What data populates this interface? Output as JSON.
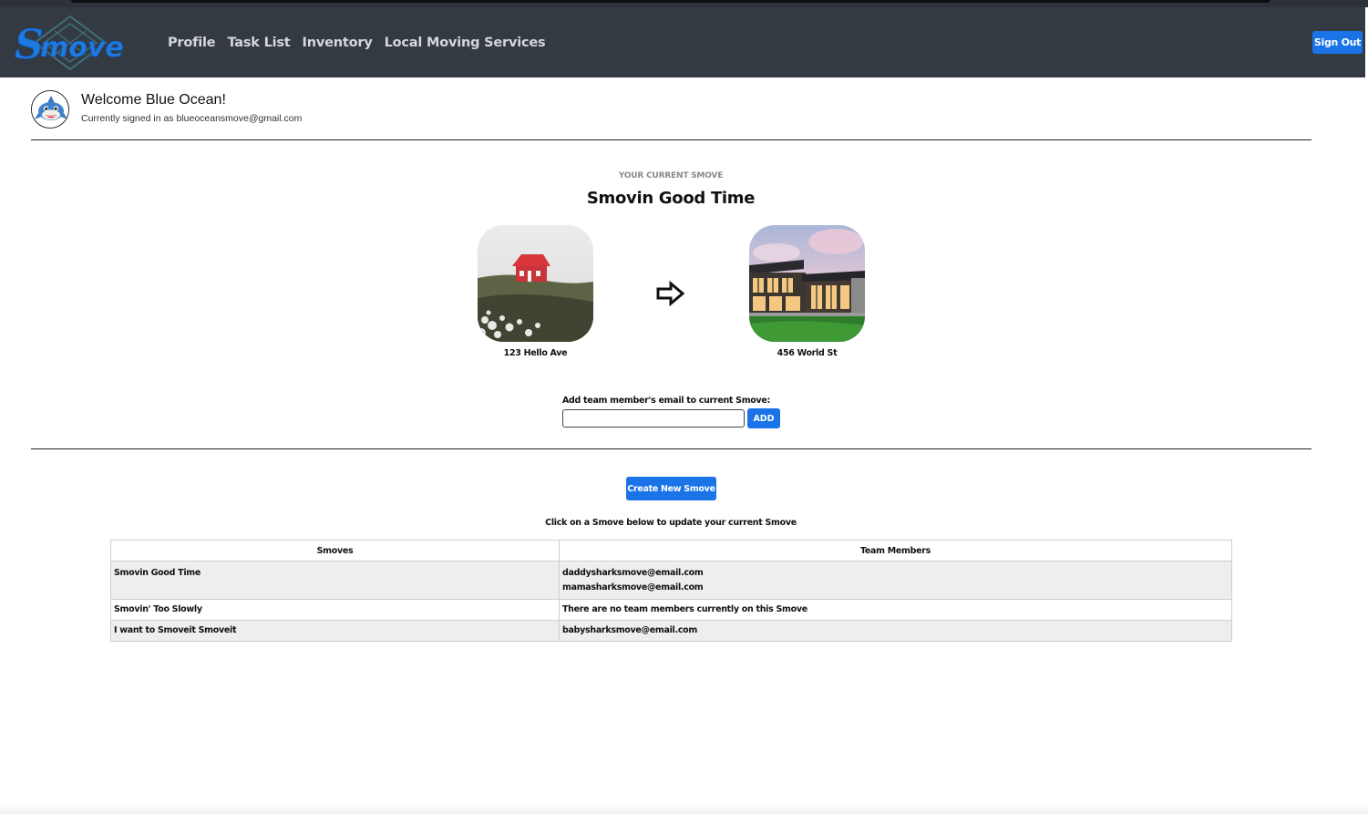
{
  "app": {
    "logo_text": "Smove",
    "brand_color": "#1a74e8"
  },
  "nav": {
    "links": [
      "Profile",
      "Task List",
      "Inventory",
      "Local Moving Services"
    ],
    "sign_out": "Sign Out"
  },
  "user": {
    "welcome": "Welcome Blue Ocean!",
    "signed_in": "Currently signed in as blueoceansmove@gmail.com"
  },
  "current_smove": {
    "label": "YOUR CURRENT SMOVE",
    "title": "Smovin Good Time",
    "from_address": "123 Hello Ave",
    "to_address": "456 World St"
  },
  "team_form": {
    "label": "Add team member's email to current Smove:",
    "input_value": "",
    "add_button": "ADD"
  },
  "create_button": "Create New Smove",
  "instruction": "Click on a Smove below to update your current Smove",
  "table": {
    "headers": [
      "Smoves",
      "Team Members"
    ],
    "rows": [
      {
        "smove": "Smovin Good Time",
        "members": [
          "daddysharksmove@email.com",
          "mamasharksmove@email.com"
        ]
      },
      {
        "smove": "Smovin' Too Slowly",
        "members": [
          "There are no team members currently on this Smove"
        ]
      },
      {
        "smove": "I want to Smoveit Smoveit",
        "members": [
          "babysharksmove@email.com"
        ]
      }
    ]
  }
}
